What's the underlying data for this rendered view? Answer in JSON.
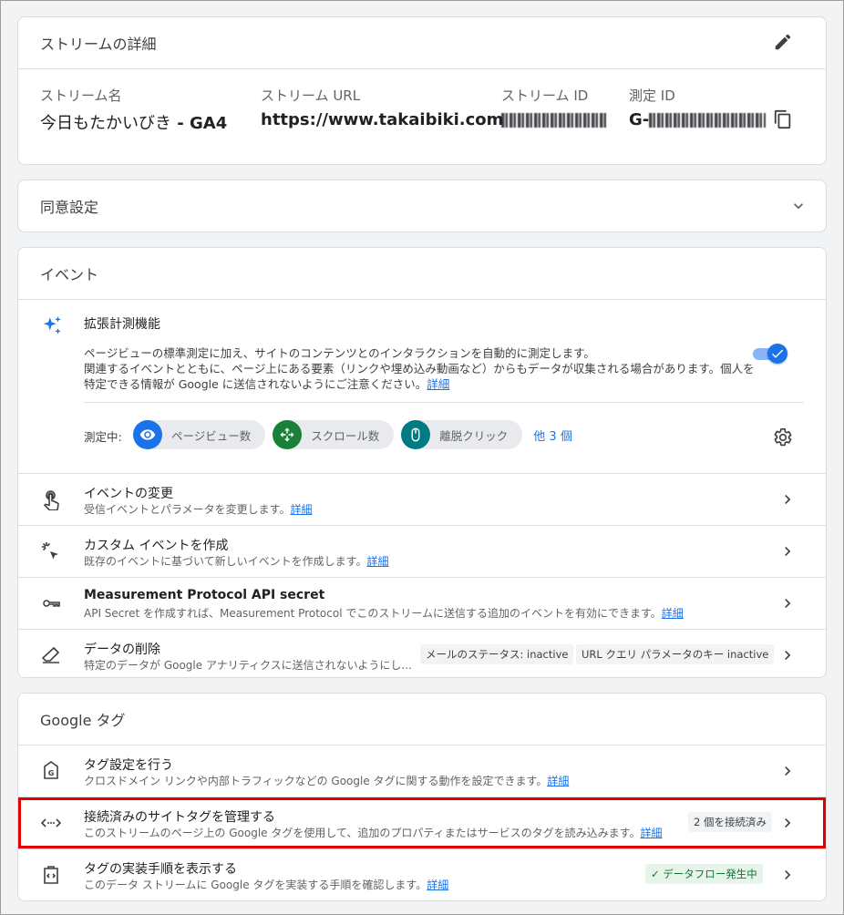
{
  "stream_details": {
    "title": "ストリームの詳細",
    "name_label": "ストリーム名",
    "name_value": "今日もたかいびき",
    "name_suffix": " - GA4",
    "url_label": "ストリーム URL",
    "url_value": "https://www.takaibiki.com",
    "id_label": "ストリーム ID",
    "measurement_id_label": "測定 ID",
    "measurement_id_prefix": "G-"
  },
  "consent": {
    "title": "同意設定"
  },
  "events": {
    "title": "イベント",
    "enhanced": {
      "title": "拡張計測機能",
      "desc_line1": "ページビューの標準測定に加え、サイトのコンテンツとのインタラクションを自動的に測定します。",
      "desc_line2": "関連するイベントとともに、ページ上にある要素（リンクや埋め込み動画など）からもデータが収集される場合があります。個人を",
      "desc_line3": "特定できる情報が Google に送信されないようにご注意ください。",
      "details_link": "詳細",
      "toggle_on": true,
      "measuring_label": "測定中:",
      "chips": [
        {
          "label": "ページビュー数",
          "icon": "eye-icon",
          "color": "#1a73e8"
        },
        {
          "label": "スクロール数",
          "icon": "scroll-icon",
          "color": "#188038"
        },
        {
          "label": "離脱クリック",
          "icon": "mouse-icon",
          "color": "#007b83"
        }
      ],
      "more": "他 3 個"
    },
    "rows": [
      {
        "title": "イベントの変更",
        "sub": "受信イベントとパラメータを変更します。",
        "link": "詳細"
      },
      {
        "title": "カスタム イベントを作成",
        "sub": "既存のイベントに基づいて新しいイベントを作成します。",
        "link": "詳細"
      },
      {
        "title": "Measurement Protocol API secret",
        "sub": "API Secret を作成すれば、Measurement Protocol でこのストリームに送信する追加のイベントを有効にできます。",
        "link": "詳細"
      },
      {
        "title": "データの削除",
        "sub": "特定のデータが Google アナリティクスに送信されないようにし...",
        "pill1": "メールのステータス: inactive",
        "pill2": "URL クエリ パラメータのキー inactive"
      }
    ]
  },
  "google_tag": {
    "title": "Google タグ",
    "rows": [
      {
        "title": "タグ設定を行う",
        "sub": "クロスドメイン リンクや内部トラフィックなどの Google タグに関する動作を設定できます。",
        "link": "詳細"
      },
      {
        "title": "接続済みのサイトタグを管理する",
        "sub": "このストリームのページ上の Google タグを使用して、追加のプロパティまたはサービスのタグを読み込みます。",
        "link": "詳細",
        "pill": "2 個を接続済み"
      },
      {
        "title": "タグの実装手順を表示する",
        "sub": "このデータ ストリームに Google タグを実装する手順を確認します。",
        "link": "詳細",
        "pill": "✓ データフロー発生中"
      }
    ]
  }
}
